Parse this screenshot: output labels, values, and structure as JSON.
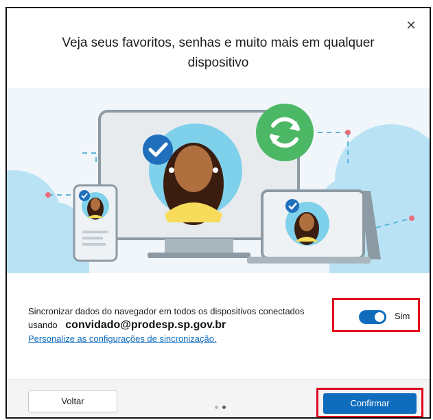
{
  "dialog": {
    "title": "Veja seus favoritos, senhas e muito mais em qualquer dispositivo",
    "close_icon": "close-icon"
  },
  "sync": {
    "description": "Sincronizar dados do navegador em todos os dispositivos conectados usando",
    "email": "convidado@prodesp.sp.gov.br",
    "link": "Personalize as configurações de sincronização.",
    "toggle_label": "Sim",
    "toggle_on": true
  },
  "footer": {
    "back_label": "Voltar",
    "confirm_label": "Confirmar",
    "page_indicator": {
      "total": 2,
      "current": 2
    }
  },
  "colors": {
    "accent": "#0f6cbd",
    "highlight_box": "#e0001b",
    "sync_green": "#4cb866",
    "cloud": "#b9e3f4"
  }
}
